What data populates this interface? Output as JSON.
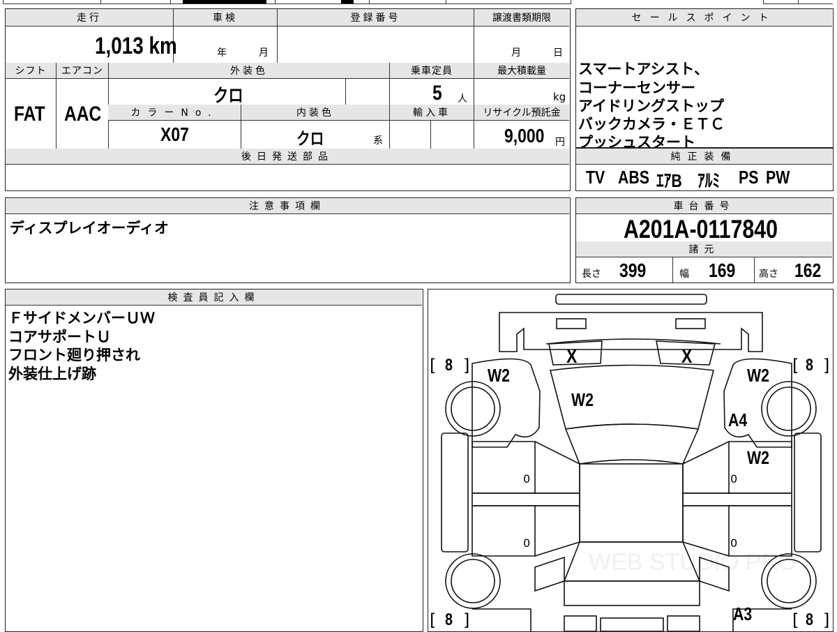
{
  "mileage": {
    "label": "走行",
    "value": "1,013 km"
  },
  "inspection": {
    "label": "車検",
    "year_label": "年",
    "month_label": "月"
  },
  "registration_number": {
    "label": "登録番号"
  },
  "transfer_deadline": {
    "label": "譲渡書類期限",
    "month_label": "月",
    "day_label": "日"
  },
  "shift": {
    "label": "シフト",
    "value": "FAT"
  },
  "aircon": {
    "label": "エアコン",
    "value": "AAC"
  },
  "exterior_color": {
    "label": "外装色",
    "value": "クロ"
  },
  "capacity": {
    "label": "乗車定員",
    "value": "5",
    "unit": "人"
  },
  "max_load": {
    "label": "最大積載量",
    "unit": "kg"
  },
  "color_no": {
    "label": "カラーNo.",
    "value": "X07"
  },
  "interior_color": {
    "label": "内装色",
    "value": "クロ",
    "suffix": "系"
  },
  "import": {
    "label": "輸入車"
  },
  "recycle_fee": {
    "label": "リサイクル預託金",
    "value": "9,000",
    "unit": "円"
  },
  "later_parts": {
    "label": "後日発送部品"
  },
  "sales_points": {
    "label": "セールスポイント",
    "lines": [
      "スマートアシスト、",
      "コーナーセンサー",
      "アイドリングストップ",
      "バックカメラ・ＥＴＣ",
      "プッシュスタート"
    ]
  },
  "genuine_equipment": {
    "label": "純正装備",
    "items": [
      "TV",
      "ABS",
      "ｴｱB",
      "ｱﾙﾐ",
      "PS",
      "PW"
    ]
  },
  "notes": {
    "label": "注意事項欄",
    "text": "ディスプレイオーディオ"
  },
  "chassis_number": {
    "label": "車台番号",
    "value": "A201A-0117840"
  },
  "specs": {
    "label": "諸元",
    "length_label": "長さ",
    "length": "399",
    "width_label": "幅",
    "width": "169",
    "height_label": "高さ",
    "height": "162"
  },
  "inspector": {
    "label": "検査員記入欄",
    "lines": [
      "ＦサイドメンバーＵＷ",
      "コアサポートＵ",
      "フロント廻り押され",
      "外装仕上げ跡"
    ]
  },
  "diagram": {
    "tire_fl": "8",
    "tire_fr": "8",
    "tire_rl": "8",
    "tire_rr": "8",
    "bracket_open": "[",
    "bracket_close": "]",
    "headlight_l": "X",
    "headlight_r": "X",
    "fender_l": "W2",
    "fender_r": "W2",
    "hood": "W2",
    "fender_r_a": "A4",
    "front_door_r": "W2",
    "door_fl": "0",
    "door_fr": "0",
    "door_rl": "0",
    "door_rr": "0",
    "rear_quarter_r": "A3",
    "watermark": "WEB STUDIO PRO"
  }
}
